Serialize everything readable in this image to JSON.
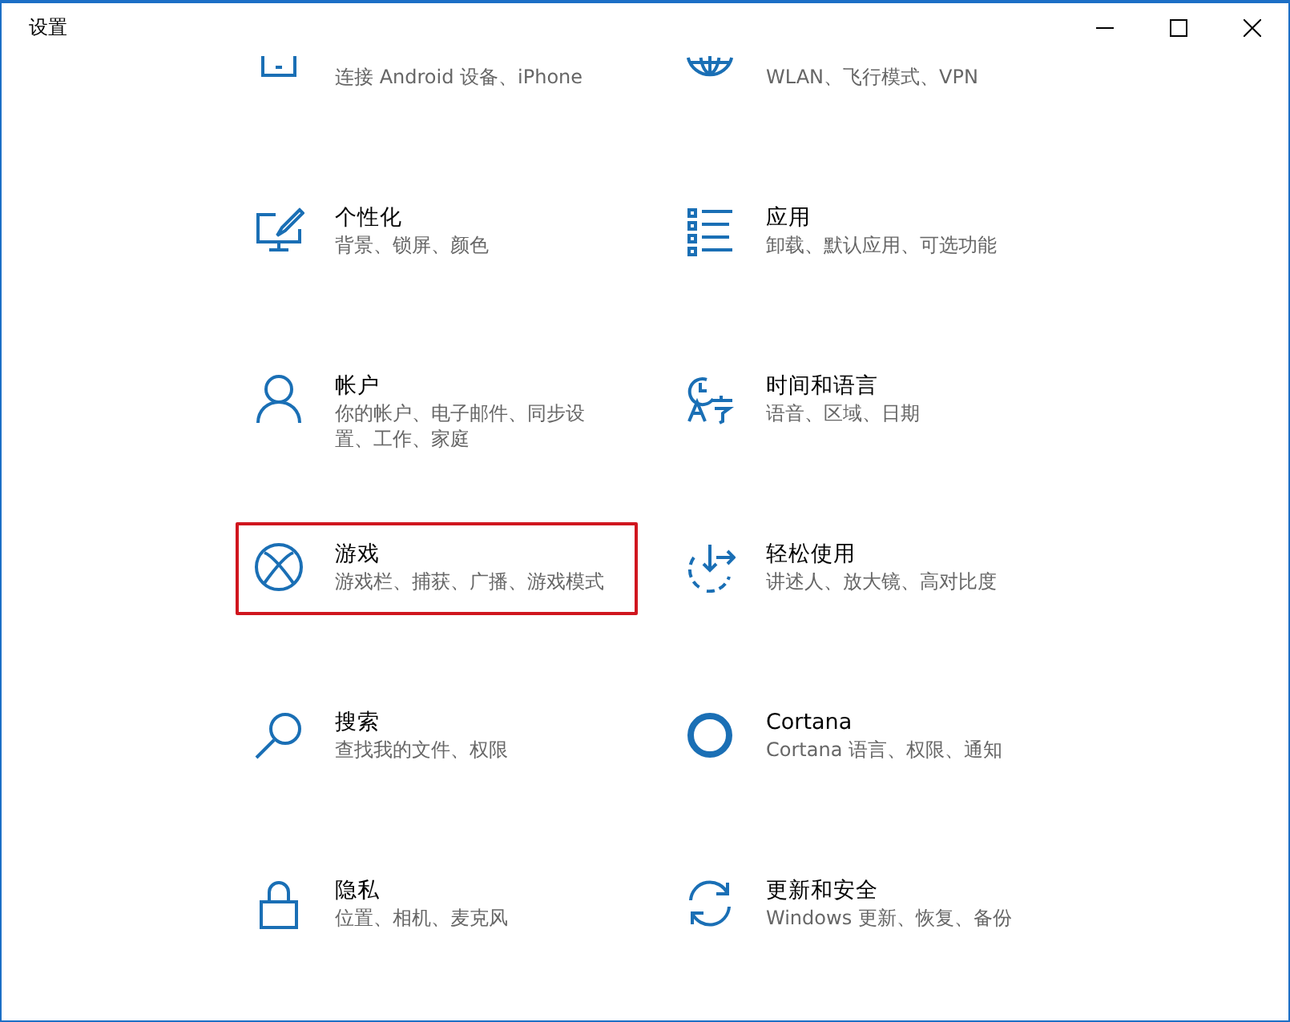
{
  "window": {
    "title": "设置"
  },
  "items": [
    {
      "description": "连接 Android 设备、iPhone",
      "highlighted": false
    },
    {
      "description": "WLAN、飞行模式、VPN",
      "highlighted": false
    },
    {
      "title": "个性化",
      "description": "背景、锁屏、颜色",
      "highlighted": false
    },
    {
      "title": "应用",
      "description": "卸载、默认应用、可选功能",
      "highlighted": false
    },
    {
      "title": "帐户",
      "description": "你的帐户、电子邮件、同步设置、工作、家庭",
      "highlighted": false
    },
    {
      "title": "时间和语言",
      "description": "语音、区域、日期",
      "highlighted": false
    },
    {
      "title": "游戏",
      "description": "游戏栏、捕获、广播、游戏模式",
      "highlighted": true
    },
    {
      "title": "轻松使用",
      "description": "讲述人、放大镜、高对比度",
      "highlighted": false
    },
    {
      "title": "搜索",
      "description": "查找我的文件、权限",
      "highlighted": false
    },
    {
      "title": "Cortana",
      "description": "Cortana 语言、权限、通知",
      "highlighted": false
    },
    {
      "title": "隐私",
      "description": "位置、相机、麦克风",
      "highlighted": false
    },
    {
      "title": "更新和安全",
      "description": "Windows 更新、恢复、备份",
      "highlighted": false
    }
  ]
}
